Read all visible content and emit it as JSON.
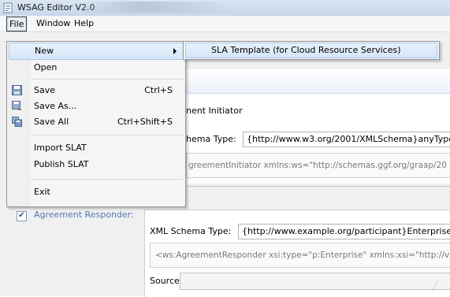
{
  "window": {
    "title": "WSAG Editor V2.0"
  },
  "menubar": {
    "file": "File",
    "window": "Window",
    "help": "Help"
  },
  "file_menu": {
    "items": [
      {
        "label": "New",
        "shortcut": ""
      },
      {
        "label": "Open",
        "shortcut": ""
      },
      {
        "label": "Save",
        "shortcut": "Ctrl+S"
      },
      {
        "label": "Save As...",
        "shortcut": ""
      },
      {
        "label": "Save All",
        "shortcut": "Ctrl+Shift+S"
      },
      {
        "label": "Import SLAT",
        "shortcut": ""
      },
      {
        "label": "Publish SLAT",
        "shortcut": ""
      },
      {
        "label": "Exit",
        "shortcut": ""
      }
    ]
  },
  "submenu": {
    "item": "SLA Template (for Cloud Resource Services)"
  },
  "initiator": {
    "label_visible": "nent Initiator",
    "schema_label_visible": "hema Type:",
    "schema_value": "{http://www.w3.org/2001/XMLSchema}anyType",
    "xml_visible": "greementInitiator xmlns:ws=\"http://schemas.ggf.org/graap/20"
  },
  "responder": {
    "checkbox_mark": "✔",
    "label": "Agreement Responder:",
    "schema_label": "XML Schema Type:",
    "schema_value": "{http://www.example.org/participant}Enterprise",
    "xml_visible": "<ws:AgreementResponder xsi:type=\"p:Enterprise\" xmlns:xsi=\"http://v",
    "source_label": "Source"
  },
  "colors": {
    "accent": "#5279b0",
    "menu_highlight": "#d6e6f8"
  }
}
